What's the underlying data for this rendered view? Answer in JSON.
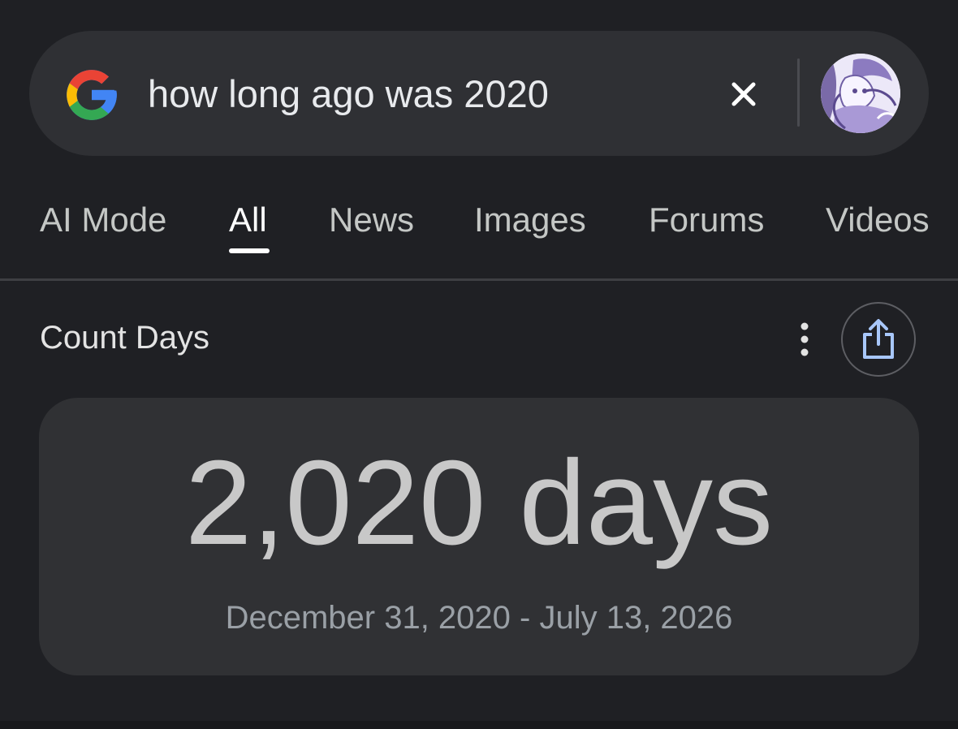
{
  "search": {
    "query": "how long ago was 2020",
    "logo_icon": "google-g-icon",
    "clear_icon": "close-icon",
    "avatar_icon": "profile-avatar"
  },
  "tabs": [
    {
      "label": "AI Mode",
      "active": false
    },
    {
      "label": "All",
      "active": true
    },
    {
      "label": "News",
      "active": false
    },
    {
      "label": "Images",
      "active": false
    },
    {
      "label": "Forums",
      "active": false
    },
    {
      "label": "Videos",
      "active": false
    }
  ],
  "count_days": {
    "title": "Count Days",
    "more_icon": "more-vert-icon",
    "share_icon": "share-icon",
    "result": "2,020 days",
    "range": "December 31, 2020 - July 13, 2026"
  },
  "colors": {
    "background": "#1f2024",
    "search_bar": "#2f3034",
    "card": "#303134",
    "share_accent": "#a8c7fa"
  }
}
